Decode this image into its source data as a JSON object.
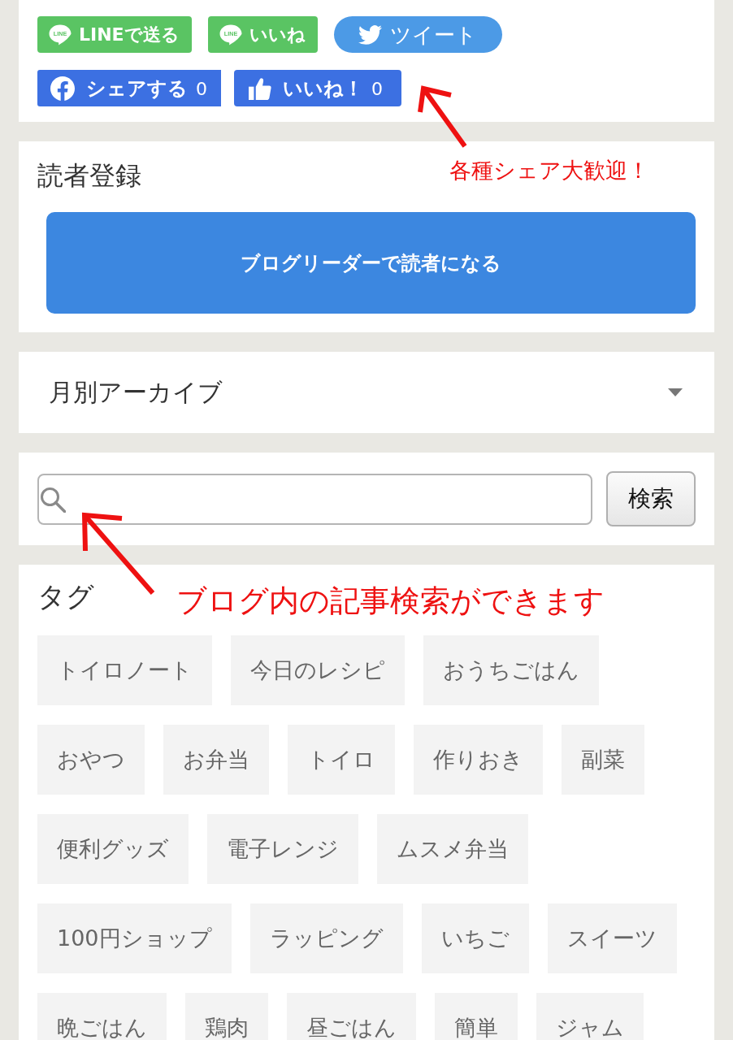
{
  "share_buttons": {
    "rows": [
      [
        {
          "kind": "line",
          "logo_text": "LINE",
          "label": "LINEで送る"
        },
        {
          "kind": "line",
          "logo_text": "LINE",
          "label": "いいね"
        },
        {
          "kind": "twitter",
          "label": "ツイート"
        }
      ],
      [
        {
          "kind": "facebook_share",
          "label": "シェアする",
          "count": "0"
        },
        {
          "kind": "facebook_like",
          "label": "いいね！",
          "count": "0"
        }
      ]
    ]
  },
  "reader": {
    "title": "読者登録",
    "button": "ブログリーダーで読者になる"
  },
  "archive": {
    "title": "月別アーカイブ",
    "expanded": false
  },
  "search": {
    "button": "検索"
  },
  "tags": {
    "title": "タグ",
    "items": [
      "トイロノート",
      "今日のレシピ",
      "おうちごはん",
      "おやつ",
      "お弁当",
      "トイロ",
      "作りおき",
      "副菜",
      "便利グッズ",
      "電子レンジ",
      "ムスメ弁当",
      "100円ショップ",
      "ラッピング",
      "いちご",
      "スイーツ",
      "晩ごはん",
      "鶏肉",
      "昼ごはん",
      "簡単",
      "ジャム"
    ]
  },
  "annotations": [
    {
      "text": "各種シェア大歓迎！"
    },
    {
      "text": "ブログ内の記事検索ができます"
    }
  ]
}
